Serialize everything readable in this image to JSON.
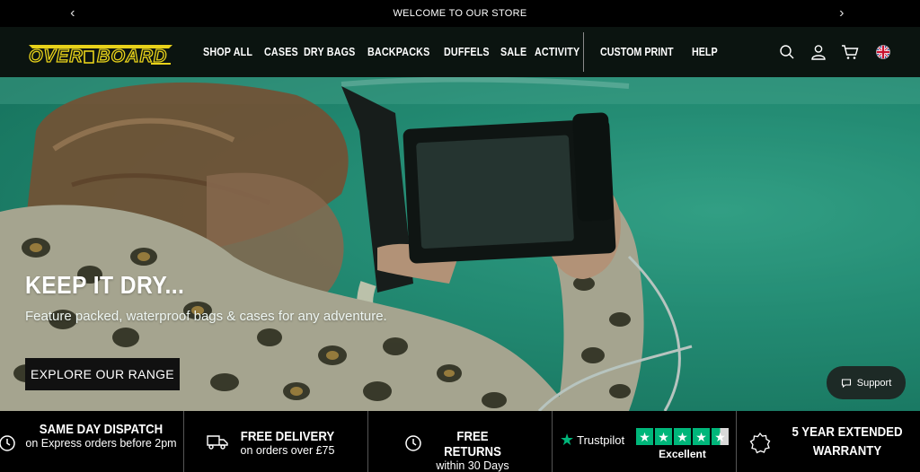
{
  "announcement": {
    "text": "WELCOME TO OUR STORE",
    "prev_icon": "chevron-left-icon",
    "next_icon": "chevron-right-icon"
  },
  "brand": {
    "logo_text": "OVERBOARD",
    "accent_color": "#e8d21a"
  },
  "nav": {
    "items": [
      "SHOP ALL",
      "CASES",
      "DRY BAGS",
      "BACKPACKS",
      "DUFFELS",
      "SALE",
      "ACTIVITY"
    ],
    "secondary": [
      "CUSTOM PRINT",
      "HELP"
    ],
    "icons": [
      "search-icon",
      "account-icon",
      "cart-icon",
      "uk-flag-icon"
    ]
  },
  "hero": {
    "title": "KEEP IT DRY...",
    "subtitle": "Feature packed, waterproof bags & cases for any adventure.",
    "cta": "EXPLORE OUR RANGE"
  },
  "support": {
    "label": "Support"
  },
  "usp": {
    "dispatch": {
      "title": "SAME DAY DISPATCH",
      "sub": "on Express orders before 2pm"
    },
    "delivery": {
      "title": "FREE DELIVERY",
      "sub": "on orders over £75"
    },
    "returns": {
      "title": "FREE RETURNS",
      "sub": "within 30 Days"
    },
    "trustpilot": {
      "brand": "Trustpilot",
      "rating_label": "Excellent",
      "stars": 4.5,
      "color": "#00b67a"
    },
    "warranty": {
      "title": "5 YEAR EXTENDED WARRANTY"
    }
  }
}
